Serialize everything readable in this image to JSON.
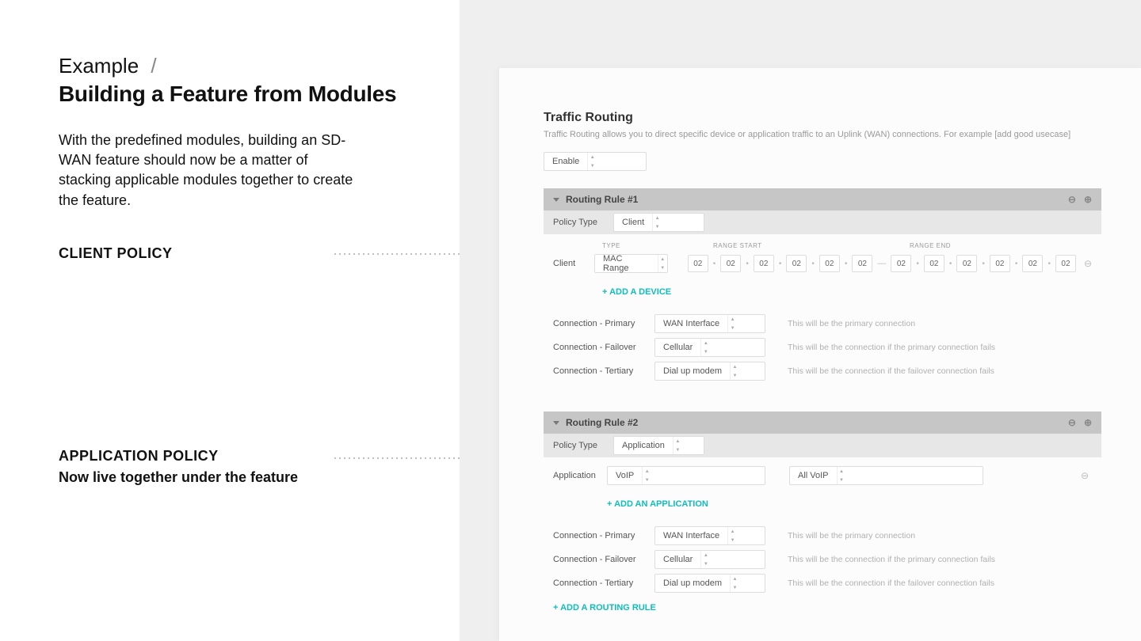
{
  "left": {
    "breadcrumb": "Example",
    "slash": "/",
    "title": "Building a Feature from Modules",
    "desc": "With the predefined modules, building an SD-WAN feature should now be a matter of stacking applicable modules together to create the feature.",
    "client_label": "CLIENT POLICY",
    "app_label": "APPLICATION POLICY",
    "app_sub": "Now live together under the feature"
  },
  "panel": {
    "title": "Traffic Routing",
    "desc": "Traffic Routing allows you to direct specific device or application traffic to an Uplink (WAN) connections. For example [add good usecase]",
    "enable": "Enable",
    "add_rule": "+ ADD A ROUTING RULE"
  },
  "labels": {
    "policy_type": "Policy Type",
    "client": "Client",
    "application": "Application",
    "type": "TYPE",
    "range_start": "RANGE START",
    "range_end": "RANGE END",
    "conn_primary": "Connection - Primary",
    "conn_failover": "Connection - Failover",
    "conn_tertiary": "Connection - Tertiary",
    "add_device": "+ ADD A DEVICE",
    "add_app": "+ ADD AN APPLICATION"
  },
  "hints": {
    "primary": "This will be the primary connection",
    "failover": "This will be the connection if the primary connection fails",
    "tertiary": "This will be the connection if the failover connection fails"
  },
  "rule1": {
    "title": "Routing Rule #1",
    "policy_type": "Client",
    "client_type": "MAC Range",
    "mac": [
      "02",
      "02",
      "02",
      "02",
      "02",
      "02"
    ],
    "conn": {
      "primary": "WAN Interface",
      "failover": "Cellular",
      "tertiary": "Dial up modem"
    }
  },
  "rule2": {
    "title": "Routing Rule #2",
    "policy_type": "Application",
    "app_cat": "VoIP",
    "app_val": "All VoIP",
    "conn": {
      "primary": "WAN Interface",
      "failover": "Cellular",
      "tertiary": "Dial up modem"
    }
  }
}
